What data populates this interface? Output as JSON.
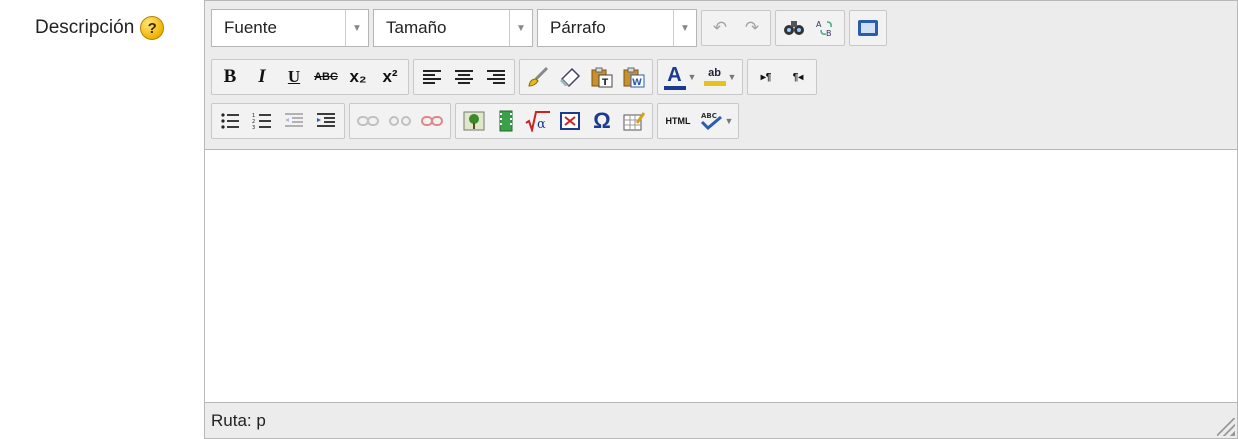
{
  "field": {
    "label": "Descripción",
    "help_glyph": "?"
  },
  "toolbar": {
    "font_select": {
      "value": "Fuente"
    },
    "size_select": {
      "value": "Tamaño"
    },
    "format_select": {
      "value": "Párrafo"
    },
    "strikethrough_glyph": "ABC",
    "bold_glyph": "B",
    "italic_glyph": "I",
    "underline_glyph": "U",
    "subscript_glyph": "x₂",
    "superscript_glyph": "x²",
    "forecolor_glyph": "A",
    "highlight_glyph": "ab",
    "omega_glyph": "Ω",
    "html_glyph": "HTML",
    "spell_glyph": "ABC"
  },
  "statusbar": {
    "path": "Ruta: p"
  },
  "colors": {
    "toolbar_bg": "#ececec",
    "border": "#b8b8b8",
    "help_icon": "#f0b400"
  }
}
